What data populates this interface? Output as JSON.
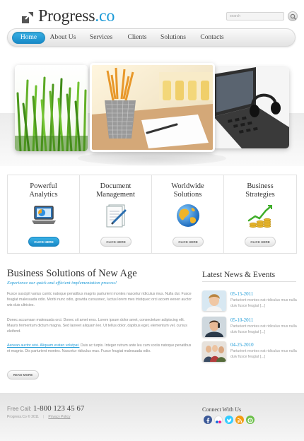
{
  "header": {
    "logo_main": "Progress",
    "logo_suffix": ".co",
    "search_placeholder": "search",
    "colors": {
      "accent": "#1e9bd7"
    }
  },
  "nav": {
    "items": [
      {
        "label": "Home",
        "active": true
      },
      {
        "label": "About Us"
      },
      {
        "label": "Services"
      },
      {
        "label": "Clients"
      },
      {
        "label": "Solutions"
      },
      {
        "label": "Contacts"
      }
    ]
  },
  "banner": {
    "images": [
      "grass-photo",
      "pencil-cup-photo",
      "laptop-headset-photo"
    ]
  },
  "features": [
    {
      "title_line1": "Powerful",
      "title_line2": "Analytics",
      "icon": "laptop-chart-icon",
      "button": "CLICK HERE"
    },
    {
      "title_line1": "Document",
      "title_line2": "Management",
      "icon": "document-pen-icon",
      "button": "CLICK HERE"
    },
    {
      "title_line1": "Worldwide",
      "title_line2": "Solutions",
      "icon": "globe-icon",
      "button": "CLICK HERE"
    },
    {
      "title_line1": "Business",
      "title_line2": "Strategies",
      "icon": "coins-graph-icon",
      "button": "CLICK HERE"
    }
  ],
  "main": {
    "title": "Business Solutions of New Age",
    "subtitle": "Experience our quick and efficient implementation process!",
    "paragraph1": "Fusce suscipit varius cumtc natoque penatibus magnis parturient montes nascetur ridiculus mus. Nulla dui. Fusce feugiat malesuada odio. Morbi nunc odio, gravida cursusnec, luctus lorem mes tristiquec orci accem eenen auctor wis duis ultricies.",
    "paragraph2": "Donec accumsan malesuada orci. Donec sit amet eros. Lorem ipsum dolor amet, consectetuer adipiscing elit. Mauris fermentum dictum magna. Sed laoreet aliquam leo. Ut tellus dolor, dapibus eget, elementum vel, cursus eleifend.",
    "link_text": "Aenean auctor wisi. Aliquam eratan volutpat.",
    "paragraph3_rest": " Duis ac turpis. Integer rutrum ante leu cum sociis natoque penatibus et magnis. Dis parturient montes. Nascetur ridiculus mus. Fusce feugiat malesuada odio.",
    "read_more": "READ MORE"
  },
  "news": {
    "title": "Latest News & Events",
    "items": [
      {
        "date": "05-15-2011",
        "text": "Parturient montes nat ridiculus mus nulla duiv fusce feugiat [...]",
        "thumb": "woman-photo"
      },
      {
        "date": "05-10-2011",
        "text": "Parturient montes nat ridiculus mus nulla duiv fusce feugiat [...]",
        "thumb": "man-photo"
      },
      {
        "date": "04-25-2010",
        "text": "Parturient montes nat ridiculus mus nulla duiv fusce feugiat [...]",
        "thumb": "group-photo"
      }
    ]
  },
  "footer": {
    "free_call_label": "Free Call:",
    "phone": "1-800 123 45 67",
    "copyright": "Progress.Co © 2011",
    "privacy": "Privacy Policy",
    "connect_title": "Connect With Us",
    "social": [
      {
        "name": "facebook-icon",
        "color": "#3b5998"
      },
      {
        "name": "flickr-icon",
        "color": "#ff0084"
      },
      {
        "name": "twitter-icon",
        "color": "#33ccff"
      },
      {
        "name": "rss-icon",
        "color": "#f39c12"
      },
      {
        "name": "skype-icon",
        "color": "#6cc04a"
      }
    ]
  }
}
